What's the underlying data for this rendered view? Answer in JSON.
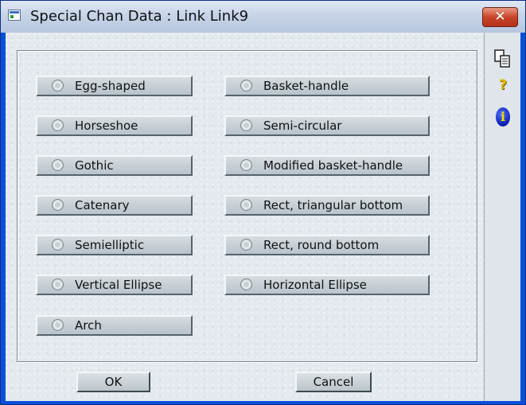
{
  "window": {
    "title": "Special Chan Data : Link Link9",
    "close_glyph": "✕"
  },
  "options": {
    "left": [
      "Egg-shaped",
      "Horseshoe",
      "Gothic",
      "Catenary",
      "Semielliptic",
      "Vertical Ellipse",
      "Arch"
    ],
    "right": [
      "Basket-handle",
      "Semi-circular",
      "Modified basket-handle",
      "Rect, triangular bottom",
      "Rect, round bottom",
      "Horizontal Ellipse"
    ]
  },
  "buttons": {
    "ok_label": "OK",
    "cancel_label": "Cancel"
  },
  "side_panel": {
    "icons": [
      "copy-icon",
      "help-icon",
      "info-icon"
    ],
    "help_glyph": "?",
    "info_glyph": "i"
  }
}
